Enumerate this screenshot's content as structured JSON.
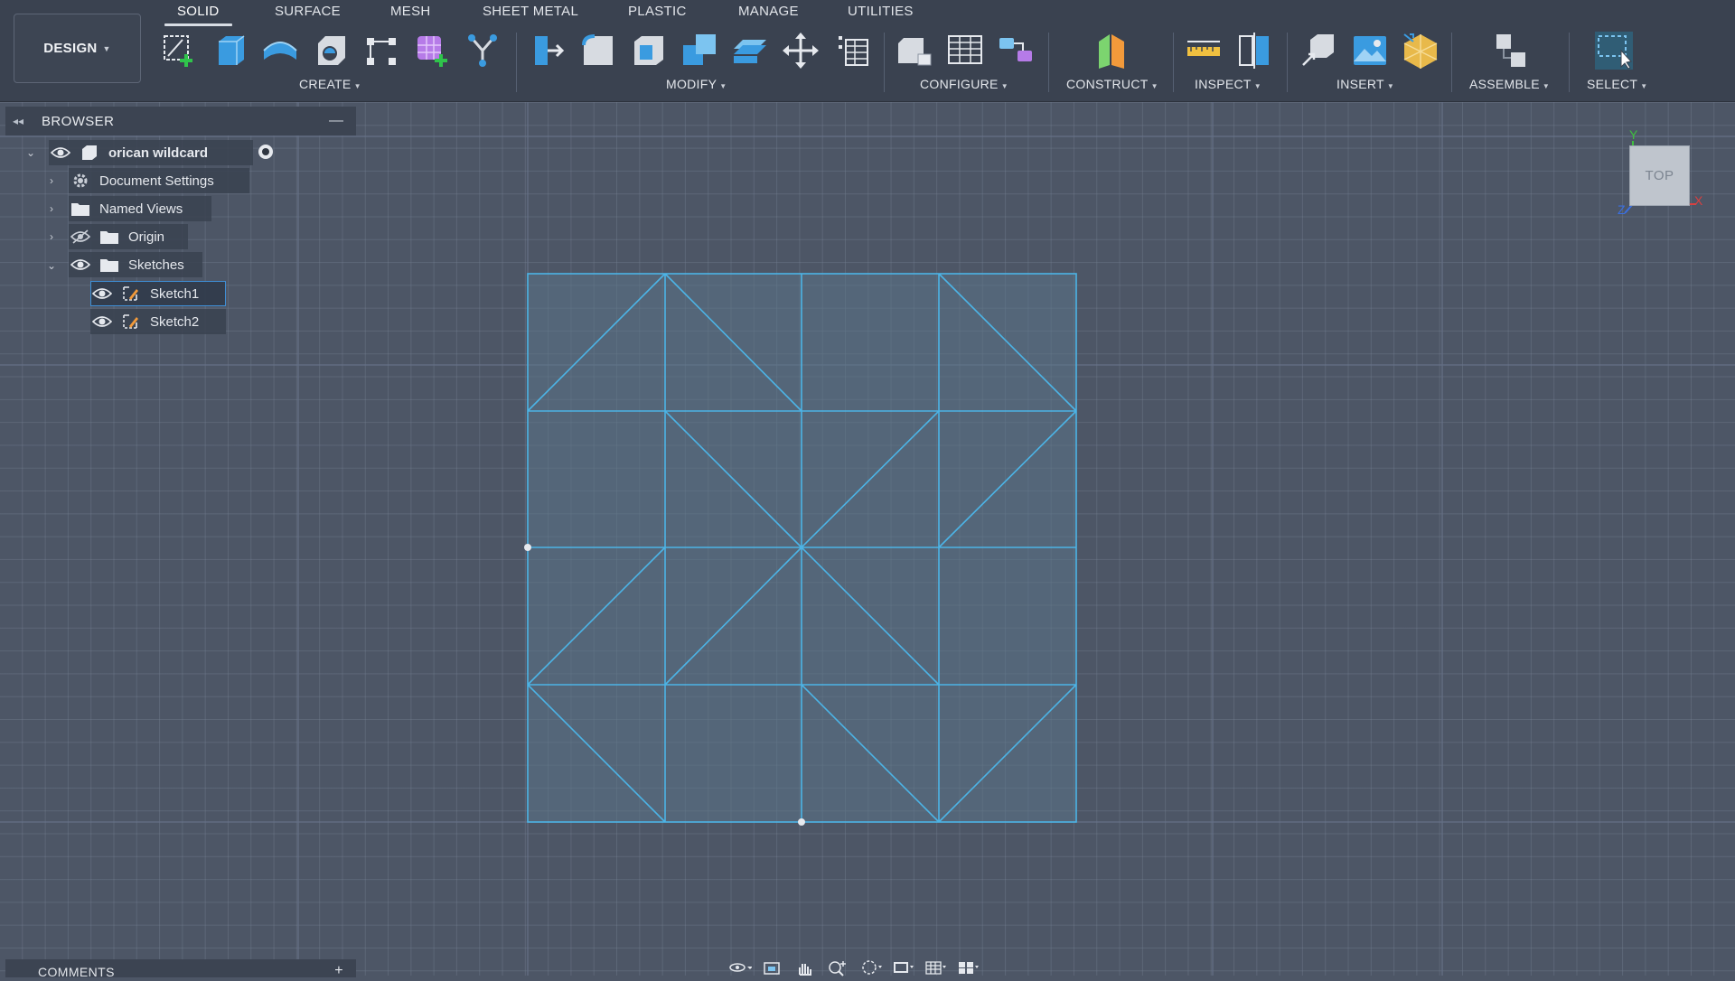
{
  "workspace": {
    "label": "DESIGN"
  },
  "tabs": [
    {
      "label": "SOLID",
      "active": true
    },
    {
      "label": "SURFACE"
    },
    {
      "label": "MESH"
    },
    {
      "label": "SHEET METAL"
    },
    {
      "label": "PLASTIC"
    },
    {
      "label": "MANAGE"
    },
    {
      "label": "UTILITIES"
    }
  ],
  "groups": {
    "create": "CREATE",
    "modify": "MODIFY",
    "configure": "CONFIGURE",
    "construct": "CONSTRUCT",
    "inspect": "INSPECT",
    "insert": "INSERT",
    "assemble": "ASSEMBLE",
    "select": "SELECT"
  },
  "tools": {
    "create": [
      "create-sketch-icon",
      "extrude-icon",
      "revolve-icon",
      "hole-icon",
      "pattern-icon",
      "create-form-icon",
      "derive-icon"
    ],
    "modify": [
      "press-pull-icon",
      "fillet-icon",
      "shell-icon",
      "combine-icon",
      "offset-face-icon",
      "move-icon",
      "parameters-icon"
    ],
    "configure": [
      "configure-table-icon",
      "table-icon",
      "rule-icon"
    ],
    "construct": [
      "plane-icon"
    ],
    "inspect": [
      "measure-icon",
      "section-icon"
    ],
    "insert": [
      "insert-derive-icon",
      "insert-image-icon",
      "insert-mesh-icon"
    ],
    "assemble": [
      "joint-icon"
    ],
    "select": [
      "select-window-icon"
    ]
  },
  "browser": {
    "title": "BROWSER",
    "items": [
      {
        "label": "orican wildcard",
        "expanded": true,
        "visible": true
      },
      {
        "label": "Document Settings",
        "icon": "gear-icon"
      },
      {
        "label": "Named Views",
        "icon": "folder-icon"
      },
      {
        "label": "Origin",
        "icon": "folder-icon",
        "visible": false
      },
      {
        "label": "Sketches",
        "icon": "folder-icon",
        "expanded": true,
        "visible": true
      },
      {
        "label": "Sketch1",
        "icon": "sketch-icon",
        "visible": true,
        "selected": true
      },
      {
        "label": "Sketch2",
        "icon": "sketch-icon",
        "visible": true
      }
    ]
  },
  "viewcube": {
    "face": "TOP",
    "axes": [
      "Y",
      "X",
      "Z"
    ]
  },
  "comments": {
    "title": "COMMENTS"
  },
  "colors": {
    "background": "#4d5666",
    "toolbar": "#3a4250",
    "sketch_line": "#4cb4e6",
    "sketch_fill": "#5b7489",
    "selection": "#3f8fd6"
  },
  "navbar": [
    "orbit-icon",
    "look-at-icon",
    "pan-icon",
    "zoom-icon",
    "fit-icon",
    "display-settings-icon",
    "grid-icon",
    "viewports-icon"
  ]
}
